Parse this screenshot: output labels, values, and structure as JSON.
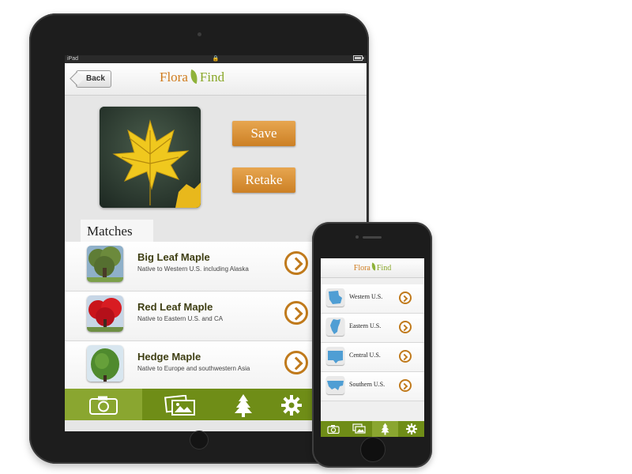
{
  "ipad": {
    "status": {
      "carrier": "iPad",
      "lock": "🔒"
    },
    "nav": {
      "back_label": "Back",
      "logo_left": "Flora",
      "logo_right": "Find"
    },
    "actions": {
      "save_label": "Save",
      "retake_label": "Retake"
    },
    "matches_heading": "Matches",
    "matches": [
      {
        "name": "Big Leaf Maple",
        "description": "Native to Western U.S. including Alaska"
      },
      {
        "name": "Red Leaf Maple",
        "description": "Native to Eastern U.S. and CA"
      },
      {
        "name": "Hedge Maple",
        "description": "Native to Europe and southwestern  Asia"
      }
    ],
    "tabs": [
      "camera-icon",
      "photos-icon",
      "tree-icon",
      "gear-icon"
    ],
    "active_tab": "camera-icon"
  },
  "iphone": {
    "nav": {
      "logo_left": "Flora",
      "logo_right": "Find"
    },
    "regions": [
      {
        "label": "Western U.S."
      },
      {
        "label": "Eastern U.S."
      },
      {
        "label": "Central U.S."
      },
      {
        "label": "Southern U.S."
      }
    ],
    "tabs": [
      "camera-icon",
      "photos-icon",
      "tree-icon",
      "gear-icon"
    ],
    "active_tab": "tree-icon"
  },
  "colors": {
    "accent_orange": "#d07c1e",
    "leaf_green": "#8aa82a",
    "tabbar_green": "#6f8d17",
    "map_blue": "#4f9ed4"
  }
}
